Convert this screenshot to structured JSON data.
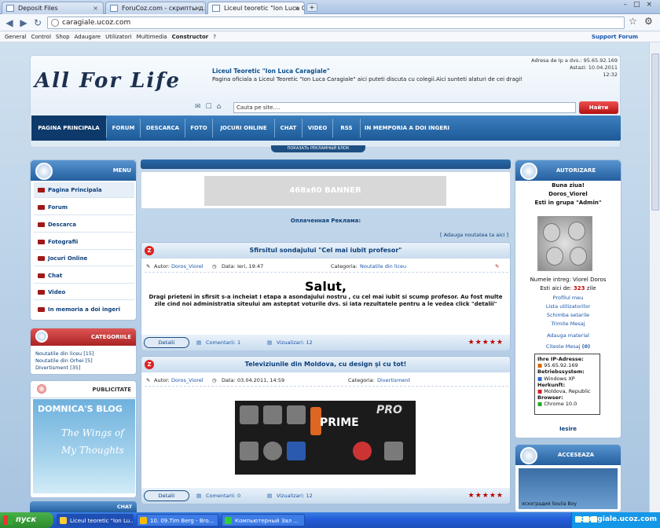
{
  "browser": {
    "tabs": [
      {
        "label": "Deposit Files",
        "active": false
      },
      {
        "label": "ForuCoz.com - скрипты д...",
        "active": false
      },
      {
        "label": "Liceul teoretic \"Ion Luca Ca...",
        "active": true
      }
    ],
    "url": "caragiale.ucoz.com"
  },
  "ucoz_bar": {
    "items": [
      "General",
      "Control",
      "Shop",
      "Adaugare",
      "Utilizatori",
      "Multimedia",
      "Constructor",
      "?"
    ],
    "support": "Support Forum"
  },
  "header": {
    "logo": "All For Life",
    "title": "Liceul Teoretic \"Ion Luca Caragiale\"",
    "description": "Pagina oficiala a Liceul Teoretic \"Ion Luca Caragiale\" aici puteti discuta cu colegii.Aici sunteti alaturi de cei dragi!",
    "ip_line": "Adresa de Ip a dvs.: 95.65.92.169",
    "date_line": "Astazi: 10.04.2011",
    "time_line": "12:32",
    "search_placeholder": "Cauta pe site....",
    "search_button": "Найти",
    "reclama_button": "ПОКАЗАТЬ РЕКЛАМНЫЙ БЛОК"
  },
  "main_menu": [
    "PAGINA PRINCIPALA",
    "FORUM",
    "DESCARCA",
    "FOTO",
    "JOCURI ONLINE",
    "CHAT",
    "VIDEO",
    "RSS",
    "IN MEMPORIA A DOI INGERI"
  ],
  "left_menu": {
    "title": "MENU",
    "items": [
      "Pagina Principala",
      "Forum",
      "Descarca",
      "Fotografii",
      "Jocuri Online",
      "Chat",
      "Video",
      "In memoria a doi ingeri"
    ]
  },
  "categories": {
    "title": "CATEGORIILE",
    "items": [
      "Noutatile din liceu [15]",
      "Noutatile din Orhei [5]",
      "Divertisment [35]"
    ]
  },
  "publicitate": {
    "title": "PUBLICITATE",
    "blog_title": "DOMNICA'S BLOG",
    "blog_sub": "The Wings of My Thoughts"
  },
  "chat_title": "CHAT",
  "banner": "468x60 BANNER",
  "paid_ads": "Оплаченная Реклама:",
  "add_news": "[ Adauga noutatea ta aici ]",
  "posts": [
    {
      "title": "Sfirsitul sondajului \"Cel mai iubit profesor\"",
      "author_label": "Autor:",
      "author": "Doros_Viorel",
      "date_label": "Data:",
      "date": "Ieri, 19:47",
      "cat_label": "Categoria:",
      "category": "Noutatile din liceu",
      "heading": "Salut,",
      "body": "Dragi prieteni in sfirsit s-a incheiat I etapa a asondajului nostru , cu cel mai iubit si scump profesor. Au fost multe zile cind noi administratia siteului am asteptat voturile dvs. si iata rezultatele pentru a le vedea click \"detalii\"",
      "details": "Detalii",
      "comments": "Comentarii: 1",
      "views": "Vizualizari: 12",
      "stars": 5
    },
    {
      "title": "Televiziunile din Moldova, cu design şi cu tot!",
      "author_label": "Autor:",
      "author": "Doros_Viorel",
      "date_label": "Data:",
      "date": "03.04.2011, 14:59",
      "cat_label": "Categoria:",
      "category": "Divertisment",
      "image_text": "PRIME",
      "image_text2": "PRO",
      "details": "Detalii",
      "comments": "Comentarii: 0",
      "views": "Vizualizari: 12",
      "stars": 5
    }
  ],
  "auth": {
    "title": "AUTORIZARE",
    "greeting": "Buna ziua!",
    "user": "Doros_Viorel",
    "group": "Esti in grupa \"Admin\"",
    "fullname": "Numele intreg: Viorel Doros",
    "days_prefix": "Esti aici de:",
    "days": "323",
    "days_suffix": "zile",
    "links": [
      "Profilul meu",
      "Lista utilizatorilor",
      "Schimba setarile",
      "Trimite Mesaj",
      "Adauga material"
    ],
    "read_msg": "Citeste Mesaj",
    "read_count": "(0)",
    "ip_title": "Ihre IP-Adresse:",
    "ip": "95.65.92.169",
    "os_title": "Betriebssystem:",
    "os": "Windows XP",
    "origin_title": "Herkunft:",
    "origin": "Moldova, Republic",
    "browser_title": "Browser:",
    "browser": "Chrome 10.0",
    "logout": "Iesire"
  },
  "acceseaza": {
    "title": "ACCESEAZA",
    "caption": "ясхоградия Soulia Boy"
  },
  "taskbar": {
    "start": "пуск",
    "tasks": [
      "Liceul teoretic \"Ion Lu...",
      "10. 09.Tim Berg - Bro...",
      "Компьютерный Зал ..."
    ],
    "watermark": "caragiale.ucoz.com"
  }
}
